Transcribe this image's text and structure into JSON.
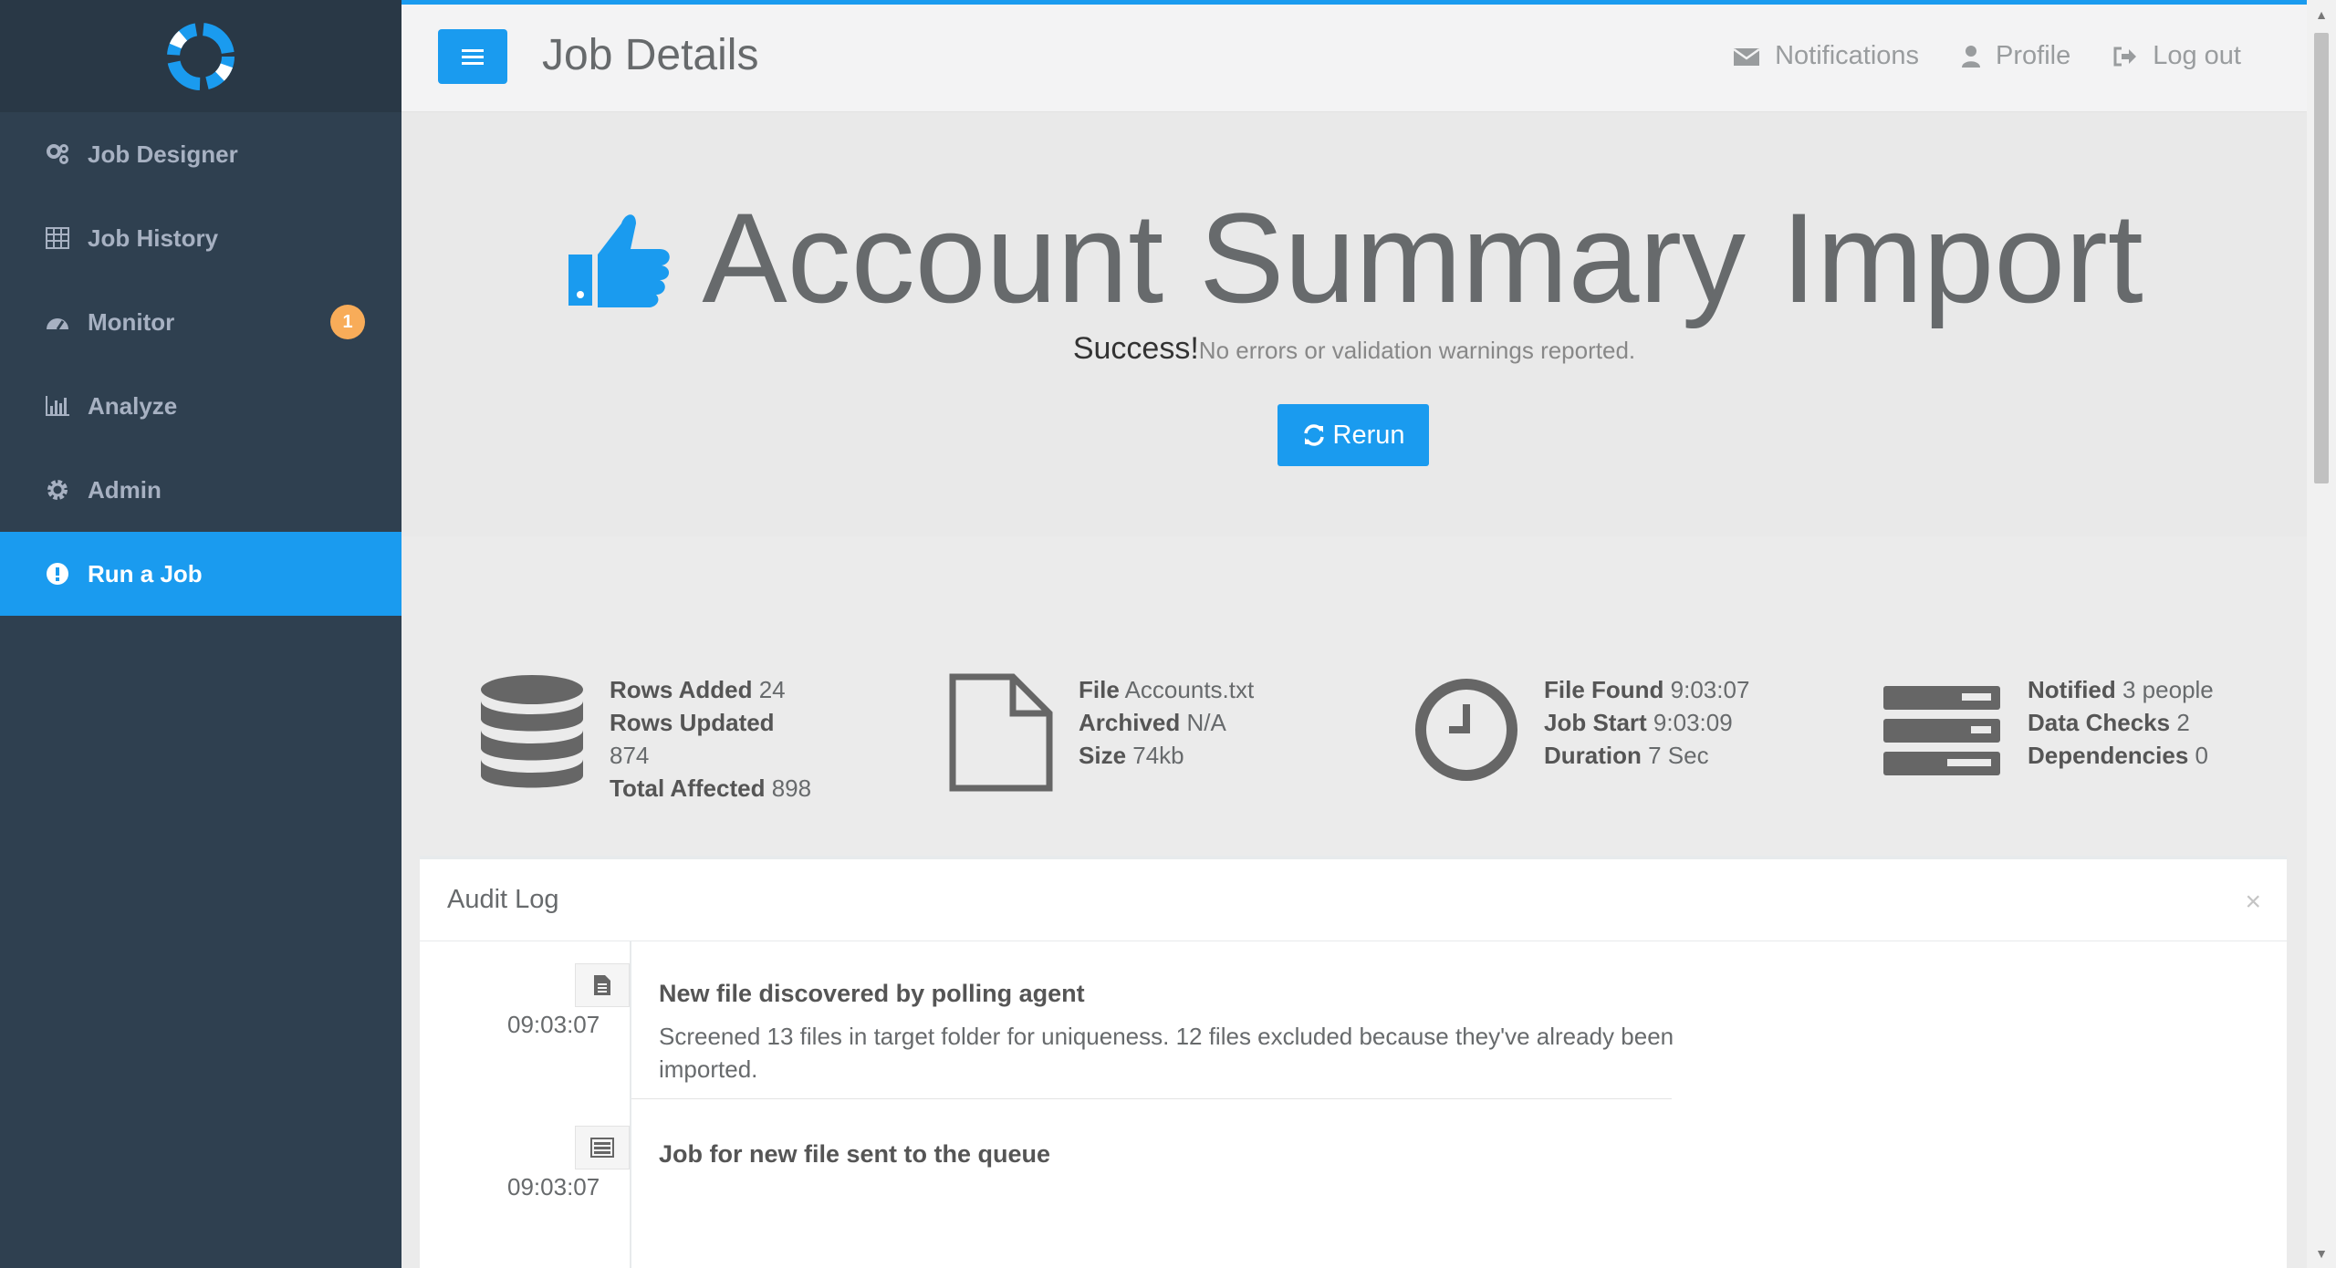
{
  "sidebar": {
    "items": [
      {
        "label": "Job Designer",
        "icon": "cogs-icon"
      },
      {
        "label": "Job History",
        "icon": "table-icon"
      },
      {
        "label": "Monitor",
        "icon": "dashboard-icon",
        "badge": "1"
      },
      {
        "label": "Analyze",
        "icon": "bar-chart-icon"
      },
      {
        "label": "Admin",
        "icon": "gear-icon"
      },
      {
        "label": "Run a Job",
        "icon": "exclamation-icon",
        "active": true
      }
    ]
  },
  "header": {
    "title": "Job Details",
    "notifications": "Notifications",
    "profile": "Profile",
    "logout": "Log out"
  },
  "hero": {
    "title": "Account Summary Import",
    "status_strong": "Success!",
    "status_msg": "No errors or validation warnings reported.",
    "rerun": "Rerun"
  },
  "stats": {
    "rows": {
      "added_label": "Rows Added",
      "added_value": "24",
      "updated_label": "Rows Updated",
      "updated_value": "874",
      "total_label": "Total Affected",
      "total_value": "898"
    },
    "file": {
      "file_label": "File",
      "file_value": "Accounts.txt",
      "archived_label": "Archived",
      "archived_value": "N/A",
      "size_label": "Size",
      "size_value": "74kb"
    },
    "timing": {
      "found_label": "File Found",
      "found_value": "9:03:07",
      "start_label": "Job Start",
      "start_value": "9:03:09",
      "duration_label": "Duration",
      "duration_value": "7 Sec"
    },
    "notify": {
      "notified_label": "Notified",
      "notified_value": "3 people",
      "checks_label": "Data Checks",
      "checks_value": "2",
      "deps_label": "Dependencies",
      "deps_value": "0"
    }
  },
  "audit": {
    "title": "Audit Log",
    "close": "×",
    "entries": [
      {
        "time": "09:03:07",
        "title": "New file discovered by polling agent",
        "desc": "Screened 13 files in target folder for uniqueness. 12 files excluded because they've already been imported."
      },
      {
        "time": "09:03:07",
        "title": "Job for new file sent to the queue",
        "desc": ""
      }
    ]
  },
  "colors": {
    "accent": "#1a9bef",
    "sidebar": "#2f4050",
    "badge": "#f8ac59"
  }
}
